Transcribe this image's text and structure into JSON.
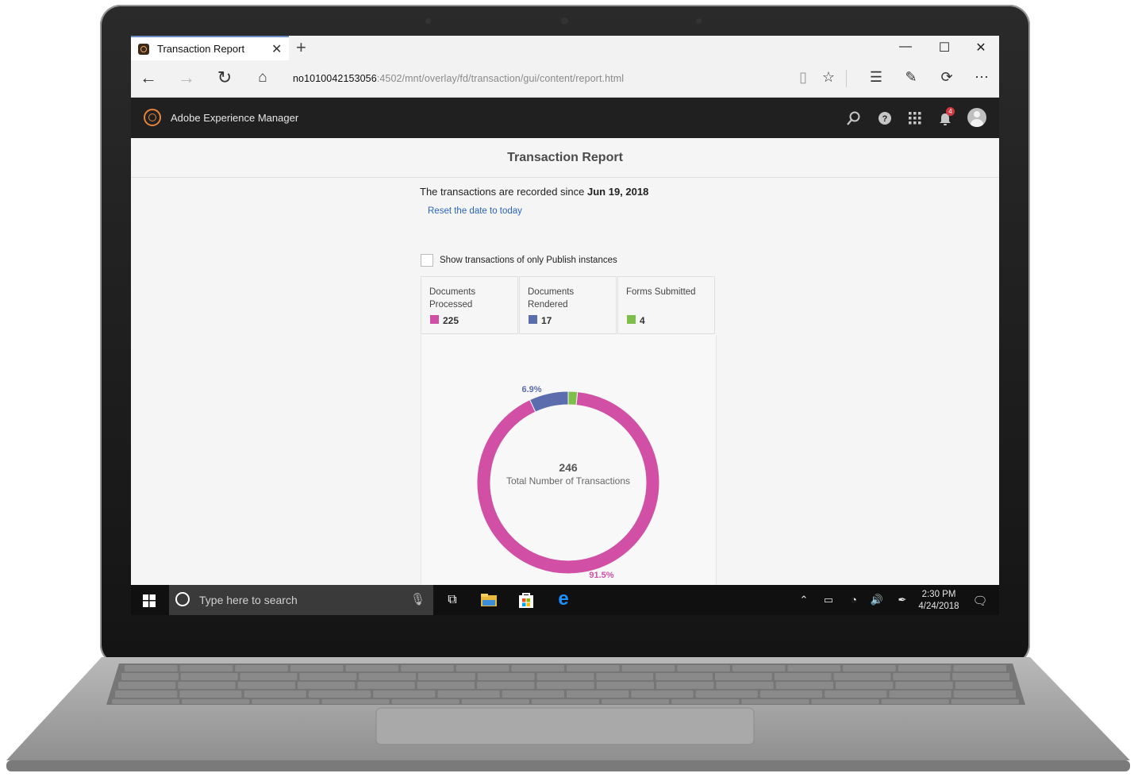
{
  "browser": {
    "tab_title": "Transaction Report",
    "url_host": "no1010042153056",
    "url_path": ":4502/mnt/overlay/fd/transaction/gui/content/report.html"
  },
  "aem": {
    "product_name": "Adobe Experience Manager",
    "notification_count": "4"
  },
  "page": {
    "title": "Transaction Report",
    "since_text": "The transactions are recorded since ",
    "since_date": "Jun 19, 2018",
    "reset_link": "Reset the date to today",
    "publish_checkbox_label": "Show transactions of only Publish instances",
    "publish_checkbox_checked": false
  },
  "cards": [
    {
      "label": "Documents Processed",
      "value": "225",
      "color": "#d14fa5"
    },
    {
      "label": "Documents Rendered",
      "value": "17",
      "color": "#5c6dad"
    },
    {
      "label": "Forms Submitted",
      "value": "4",
      "color": "#7dbf4a"
    }
  ],
  "chart_data": {
    "type": "pie",
    "donut": true,
    "center_value": "246",
    "center_label": "Total Number of Transactions",
    "slices": [
      {
        "name": "Documents Processed",
        "value": 225,
        "label": "91.5%",
        "color": "#d14fa5"
      },
      {
        "name": "Documents Rendered",
        "value": 17,
        "label": "6.9%",
        "color": "#5c6dad"
      },
      {
        "name": "Forms Submitted",
        "value": 4,
        "label": "",
        "color": "#7dbf4a"
      }
    ]
  },
  "taskbar": {
    "search_placeholder": "Type here to search",
    "time": "2:30 PM",
    "date": "4/24/2018"
  }
}
